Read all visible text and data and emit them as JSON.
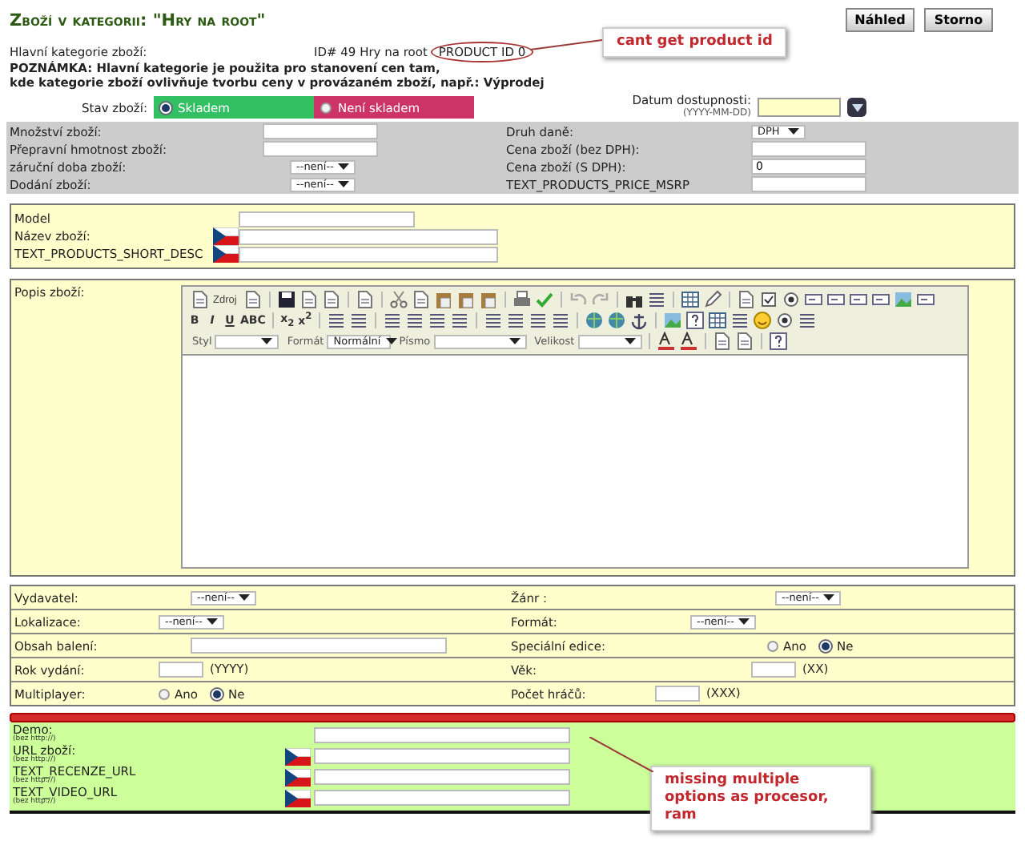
{
  "header": {
    "title": "Zboží v kategorii: \"Hry na root\"",
    "buttons": [
      "Náhled",
      "Storno"
    ]
  },
  "main_category": {
    "label": "Hlavní kategorie zboží:",
    "value": "ID# 49 Hry na root",
    "product_id": "PRODUCT ID 0"
  },
  "note": [
    "POZNÁMKA: Hlavní kategorie je použita pro stanovení cen tam,",
    "kde kategorie zboží ovlivňuje tvorbu ceny v provázaném zboží, např.: Výprodej"
  ],
  "stock": {
    "label": "Stav zboží:",
    "options": [
      {
        "label": "Skladem",
        "selected": true,
        "color": "#33c063"
      },
      {
        "label": "Není skladem",
        "selected": false,
        "color": "#cc3366"
      }
    ]
  },
  "availability": {
    "label": "Datum dostupnosti:",
    "hint": "(YYYY-MM-DD)"
  },
  "pricing": {
    "left": [
      {
        "label": "Množství zboží:",
        "kind": "text"
      },
      {
        "label": "Přepravní hmotnost zboží:",
        "kind": "text"
      },
      {
        "label": "záruční doba zboží:",
        "kind": "select",
        "value": "--není--"
      },
      {
        "label": "Dodání zboží:",
        "kind": "select",
        "value": "--není--"
      }
    ],
    "right": [
      {
        "label": "Druh daně:",
        "kind": "select",
        "value": "DPH"
      },
      {
        "label": "Cena zboží (bez DPH):",
        "kind": "text"
      },
      {
        "label": "Cena zboží (S DPH):",
        "kind": "text",
        "value": "0"
      },
      {
        "label": "TEXT_PRODUCTS_PRICE_MSRP",
        "kind": "text"
      }
    ]
  },
  "names": [
    {
      "label": "Model",
      "flag": false
    },
    {
      "label": "Název zboží:",
      "flag": true
    },
    {
      "label": "TEXT_PRODUCTS_SHORT_DESC",
      "flag": true
    }
  ],
  "description": {
    "label": "Popis zboží:",
    "source_button": "Zdroj",
    "format_buttons": [
      "B",
      "I",
      "U",
      "ABC",
      "x$_{2}$",
      "x$^{2}$"
    ],
    "selects": [
      {
        "label": "Styl"
      },
      {
        "label": "Formát",
        "value": "Normální"
      },
      {
        "label": "Písmo"
      },
      {
        "label": "Velikost"
      }
    ]
  },
  "attributes": [
    {
      "left": {
        "label": "Vydavatel:",
        "kind": "select",
        "value": "--není--"
      },
      "right": {
        "label": "Žánr :",
        "kind": "select",
        "value": "--není--"
      }
    },
    {
      "left": {
        "label": "Lokalizace:",
        "kind": "select",
        "value": "--není--"
      },
      "right": {
        "label": "Formát:",
        "kind": "select",
        "value": "--není--"
      }
    },
    {
      "left": {
        "label": "Obsah balení:",
        "kind": "wide"
      },
      "right": {
        "label": "Speciální edice:",
        "kind": "radio",
        "options": [
          {
            "label": "Ano",
            "selected": false
          },
          {
            "label": "Ne",
            "selected": true
          }
        ]
      }
    },
    {
      "left": {
        "label": "Rok vydání:",
        "kind": "text",
        "hint": "(YYYY)"
      },
      "right": {
        "label": "Věk:",
        "kind": "text",
        "hint": "(XX)"
      }
    },
    {
      "left": {
        "label": "Multiplayer:",
        "kind": "radio",
        "options": [
          {
            "label": "Ano",
            "selected": false
          },
          {
            "label": "Ne",
            "selected": true
          }
        ]
      },
      "right": {
        "label": "Počet hráčů:",
        "kind": "text",
        "hint": "(XXX)"
      }
    }
  ],
  "links": [
    {
      "label": "Demo:",
      "hint": "(bez http://)",
      "flag": false
    },
    {
      "label": "URL zboží:",
      "hint": "(bez http://)",
      "flag": true
    },
    {
      "label": "TEXT_RECENZE_URL",
      "hint": "(bez http://)",
      "flag": true
    },
    {
      "label": "TEXT_VIDEO_URL",
      "hint": "(bez http://)",
      "flag": true
    }
  ],
  "annotations": [
    {
      "text": "cant get product id"
    },
    {
      "text": "missing multiple options as procesor, ram"
    }
  ]
}
